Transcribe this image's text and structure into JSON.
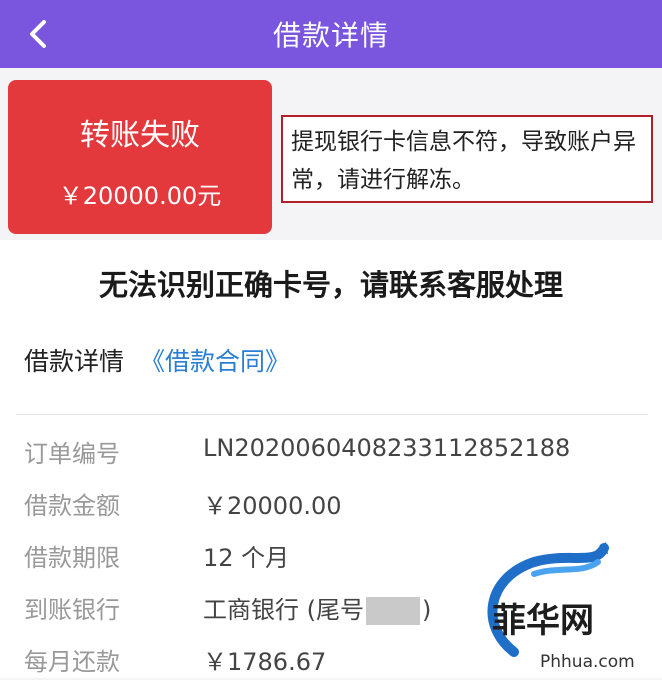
{
  "header": {
    "title": "借款详情",
    "back_icon": "chevron-left-icon"
  },
  "status": {
    "title": "转账失败",
    "amount": "￥20000.00元",
    "note": "提现银行卡信息不符，导致账户异常，请进行解冻。"
  },
  "message": "无法识别正确卡号，请联系客服处理",
  "details": {
    "label": "借款详情",
    "contract_link": "《借款合同》"
  },
  "info": {
    "order_no": {
      "label": "订单编号",
      "value": "LN2020060408233112852188"
    },
    "amount": {
      "label": "借款金额",
      "value": "￥20000.00"
    },
    "term": {
      "label": "借款期限",
      "value": "12 个月"
    },
    "bank": {
      "label": "到账银行",
      "value_prefix": "工商银行 (尾号",
      "value_suffix": ")"
    },
    "monthly": {
      "label": "每月还款",
      "value": "￥1786.67"
    }
  },
  "watermark": {
    "text": "菲华网",
    "url": "Phhua.com"
  },
  "colors": {
    "header": "#7a55de",
    "status_card": "#e4393c",
    "link": "#2a7fd4",
    "note_border": "#b01f2a"
  }
}
